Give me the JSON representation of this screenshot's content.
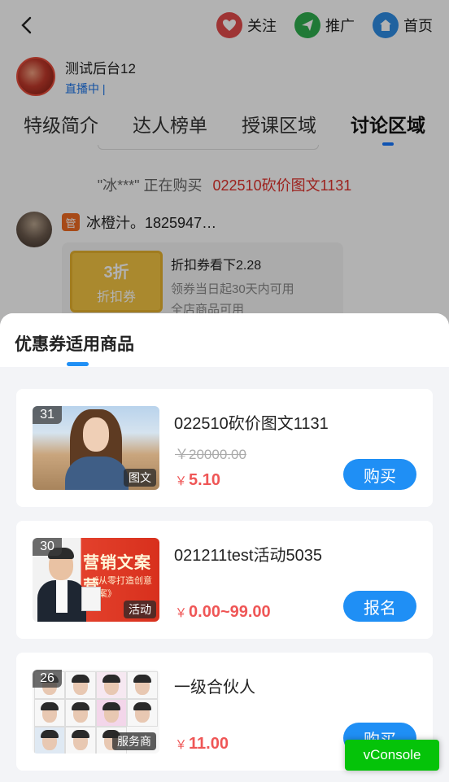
{
  "topbar": {
    "follow_label": "关注",
    "promote_label": "推广",
    "home_label": "首页"
  },
  "live": {
    "name": "测试后台12",
    "status": "直播中 |"
  },
  "tabs": [
    {
      "label": "特级简介",
      "active": false
    },
    {
      "label": "达人榜单",
      "active": false
    },
    {
      "label": "授课区域",
      "active": false
    },
    {
      "label": "讨论区域",
      "active": true
    }
  ],
  "buying_notice": {
    "user": "\"冰***\"",
    "action": "正在购买",
    "product": "022510砍价图文1131"
  },
  "message": {
    "tag": "管",
    "sender": "冰橙汁。1825947…",
    "coupon": {
      "ticket_value": "3折",
      "ticket_label": "折扣券",
      "title": "折扣券看下2.28",
      "line1": "领券当日起30天内可用",
      "line2": "全店商品可用"
    }
  },
  "sheet": {
    "title": "优惠券适用商品",
    "accent_color": "#1f8ff5",
    "products": [
      {
        "count": "31",
        "type": "图文",
        "title": "022510砍价图文1131",
        "original_price": "￥20000.00",
        "currency": "￥",
        "price": "5.10",
        "button": "购买"
      },
      {
        "count": "30",
        "type": "活动",
        "title": "021211test活动5035",
        "original_price": "",
        "currency": "￥",
        "price": "0.00~99.00",
        "button": "报名",
        "thumb_title": "营销文案营",
        "thumb_sub": "《从零打造创意文案》"
      },
      {
        "count": "26",
        "type": "服务商",
        "title": "一级合伙人",
        "original_price": "",
        "currency": "￥",
        "price": "11.00",
        "button": "购买"
      }
    ]
  },
  "vconsole_label": "vConsole"
}
